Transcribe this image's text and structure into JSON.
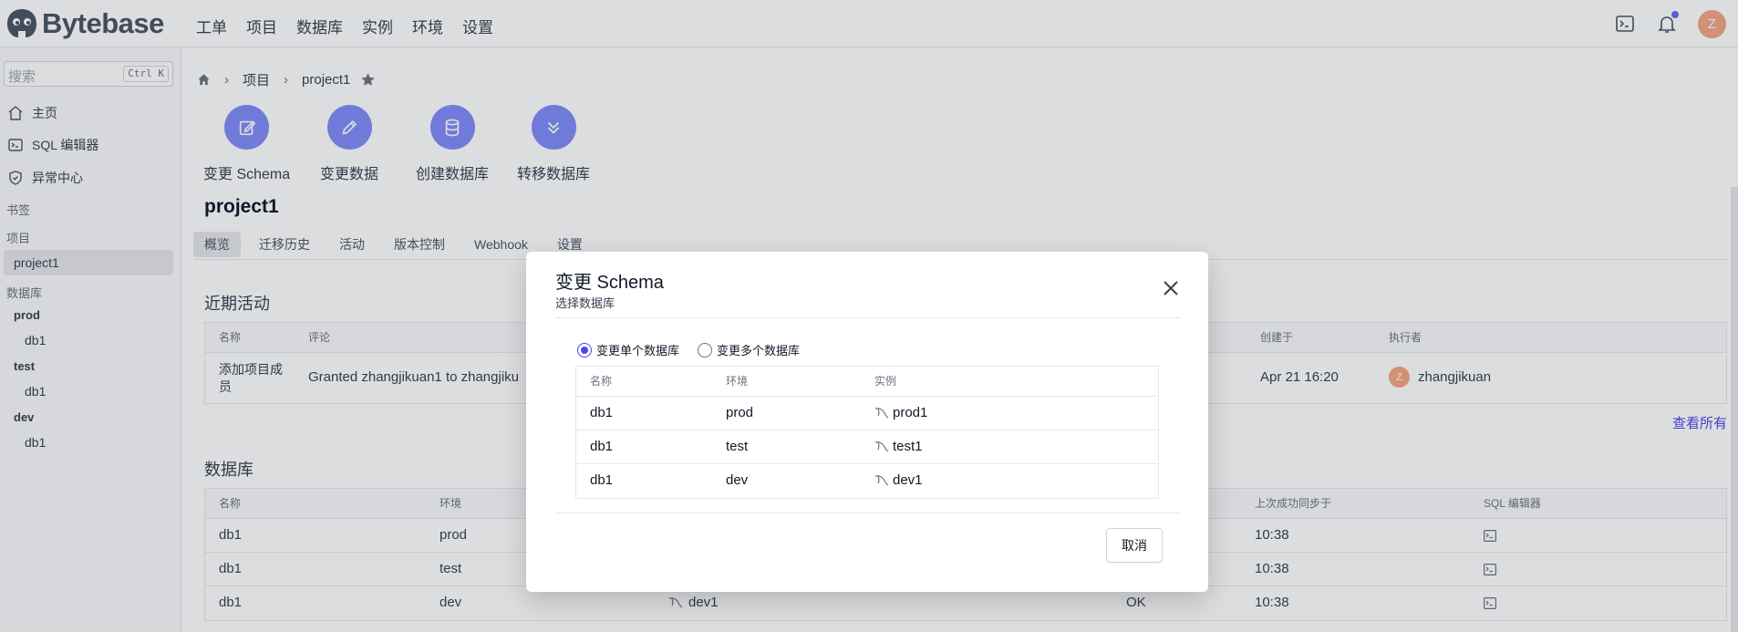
{
  "app": {
    "logo_text": "Bytebase"
  },
  "topnav": [
    "工单",
    "项目",
    "数据库",
    "实例",
    "环境",
    "设置"
  ],
  "user": {
    "avatar_initial": "Z"
  },
  "sidebar": {
    "search_placeholder": "搜索",
    "search_shortcut": "Ctrl K",
    "items": [
      {
        "label": "主页",
        "icon": "home-icon"
      },
      {
        "label": "SQL 编辑器",
        "icon": "terminal-icon"
      },
      {
        "label": "异常中心",
        "icon": "shield-icon"
      }
    ],
    "bookmarks_heading": "书签",
    "projects_heading": "项目",
    "active_project": "project1",
    "databases_heading": "数据库",
    "envs": [
      {
        "name": "prod",
        "db": "db1"
      },
      {
        "name": "test",
        "db": "db1"
      },
      {
        "name": "dev",
        "db": "db1"
      }
    ]
  },
  "breadcrumb": {
    "projects": "项目",
    "current": "project1"
  },
  "quick_actions": [
    "变更 Schema",
    "变更数据",
    "创建数据库",
    "转移数据库"
  ],
  "project": {
    "title": "project1",
    "tabs": [
      "概览",
      "迁移历史",
      "活动",
      "版本控制",
      "Webhook",
      "设置"
    ]
  },
  "activity": {
    "title": "近期活动",
    "headers": {
      "name": "名称",
      "comment": "评论",
      "created": "创建于",
      "creator": "执行者"
    },
    "row": {
      "name": "添加项目成员",
      "comment": "Granted zhangjikuan1 to zhangjiku",
      "created": "Apr 21 16:20",
      "creator_initial": "Z",
      "creator": "zhangjikuan"
    },
    "view_all": "查看所有"
  },
  "databases": {
    "title": "数据库",
    "headers": {
      "name": "名称",
      "env": "环境",
      "sync": "上次成功同步于",
      "sql": "SQL 编辑器"
    },
    "rows": [
      {
        "name": "db1",
        "env": "prod",
        "sync": "10:38"
      },
      {
        "name": "db1",
        "env": "test",
        "sync": "10:38"
      },
      {
        "name": "db1",
        "env": "dev",
        "instance": "dev1",
        "status": "OK",
        "sync": "10:38"
      }
    ]
  },
  "modal": {
    "title": "变更 Schema",
    "subtitle": "选择数据库",
    "radio_single": "变更单个数据库",
    "radio_multi": "变更多个数据库",
    "headers": {
      "name": "名称",
      "env": "环境",
      "instance": "实例"
    },
    "rows": [
      {
        "name": "db1",
        "env": "prod",
        "instance": "prod1"
      },
      {
        "name": "db1",
        "env": "test",
        "instance": "test1"
      },
      {
        "name": "db1",
        "env": "dev",
        "instance": "dev1"
      }
    ],
    "cancel": "取消"
  },
  "colors": {
    "accent": "#4f46e5",
    "quick_action_bg": "#818cf8",
    "avatar": "#f4a582"
  }
}
